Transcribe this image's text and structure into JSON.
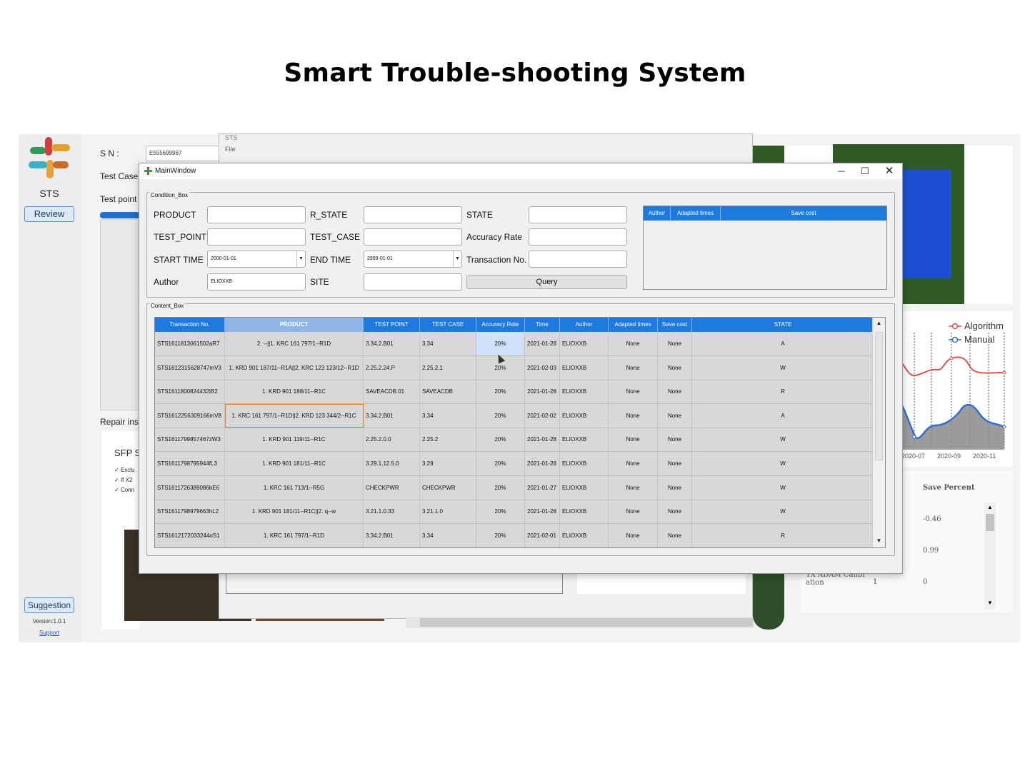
{
  "page_title": "Smart Trouble-shooting System",
  "sidebar": {
    "app_name": "STS",
    "review_label": "Review",
    "suggestion_label": "Suggestion",
    "version": "Version:1.0.1",
    "support": "Support"
  },
  "background_form": {
    "sn_label": "S N :",
    "sn_value": "E555699967",
    "test_case_label": "Test Case",
    "test_point_label": "Test point",
    "repair_label": "Repair inst",
    "sfp_label": "SFP S",
    "check_items": [
      "Exclu",
      "If X2",
      "Conn"
    ],
    "bg_window_title": "STS",
    "bg_window_menu": "File"
  },
  "main_window": {
    "title": "MainWindow",
    "condition_box_title": "Condition_Box",
    "content_box_title": "Content_Box",
    "fields": {
      "product_label": "PRODUCT",
      "r_state_label": "R_STATE",
      "state_label": "STATE",
      "test_point_label": "TEST_POINT",
      "test_case_label": "TEST_CASE",
      "accuracy_label": "Accuracy Rate",
      "start_time_label": "START TIME",
      "start_time_value": "2000-01-01",
      "end_time_label": "END TIME",
      "end_time_value": "2999-01-01",
      "transaction_label": "Transaction No.",
      "author_label": "Author",
      "author_value": "ELIOXXB",
      "site_label": "SITE",
      "query_label": "Query"
    },
    "mini_table_headers": [
      "Author",
      "Adapted times",
      "Save cost"
    ],
    "table": {
      "headers": [
        "Transaction No.",
        "PRODUCT",
        "TEST POINT",
        "TEST CASE",
        "Accuracy Rate",
        "Time",
        "Author",
        "Adapted times",
        "Save cost",
        "STATE"
      ],
      "rows": [
        [
          "STS1611813061502aR7",
          "2. --||1. KRC 161 797/1--R1D",
          "3.34.2.B01",
          "3.34",
          "20%",
          "2021-01-28",
          "ELIOXXB",
          "None",
          "None",
          "A"
        ],
        [
          "STS1612315628747mV3",
          "1. KRD 901 187/11--R1A||2. KRC 123 123/12--R1D",
          "2.25.2.24.P",
          "2.25.2.1",
          "20%",
          "2021-02-03",
          "ELIOXXB",
          "None",
          "None",
          "W"
        ],
        [
          "STS1611800824432IB2",
          "1. KRD 901 188/11--R1C",
          "SAVEACDB.01",
          "SAVEACDB",
          "20%",
          "2021-01-28",
          "ELIOXXB",
          "None",
          "None",
          "R"
        ],
        [
          "STS1612256309166mV8",
          "1. KRC 161 797/1--R1D||2. KRD 123 344/2--R1C",
          "3.34.2.B01",
          "3.34",
          "20%",
          "2021-02-02",
          "ELIOXXB",
          "None",
          "None",
          "A"
        ],
        [
          "STS1611799857467zW3",
          "1. KRD 901 119/11--R1C",
          "2.25.2.0.0",
          "2.25.2",
          "20%",
          "2021-01-28",
          "ELIOXXB",
          "None",
          "None",
          "W"
        ],
        [
          "STS1611798795944fL3",
          "1. KRD 901 181/11--R1C",
          "3.29.1.12.5.0",
          "3.29",
          "20%",
          "2021-01-28",
          "ELIOXXB",
          "None",
          "None",
          "W"
        ],
        [
          "STS1611726389086bE6",
          "1. KRC 161 713/1--R5G",
          "CHECKPWR",
          "CHECKPWR",
          "20%",
          "2021-01-27",
          "ELIOXXB",
          "None",
          "None",
          "W"
        ],
        [
          "STS1611798979663hL2",
          "1. KRD 901 181/11--R1C||2. q--w",
          "3.21.1.0.33",
          "3.21.1.0",
          "20%",
          "2021-01-28",
          "ELIOXXB",
          "None",
          "None",
          "W"
        ],
        [
          "STS1612172033244oS1",
          "1. KRC 161 797/1--R1D",
          "3.34.2.B01",
          "3.34",
          "20%",
          "2021-02-01",
          "ELIOXXB",
          "None",
          "None",
          "R"
        ]
      ]
    }
  },
  "right_chart": {
    "legend": [
      "Algorithm",
      "Manual"
    ],
    "x_ticks": [
      "2020-07",
      "2020-09",
      "2020-11"
    ],
    "colors": {
      "algorithm": "#d9534f",
      "manual": "#2f6fd6"
    }
  },
  "save_panel": {
    "header": "Save Percent",
    "values": [
      "-0.46",
      "0.99",
      "0"
    ],
    "row_label": "TX ADAM Calibr ation",
    "row_count": "1"
  }
}
